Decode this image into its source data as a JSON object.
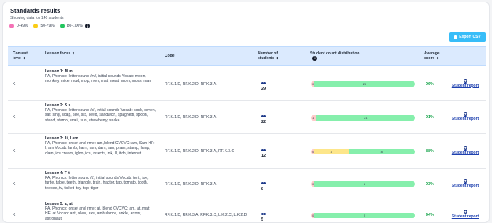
{
  "header": {
    "title": "Standards results",
    "subtitle": "Showing data for 140 students"
  },
  "legend": [
    {
      "label": "0-49%",
      "color": "#f472b6"
    },
    {
      "label": "50-79%",
      "color": "#facc15"
    },
    {
      "label": "80-100%",
      "color": "#22c55e"
    }
  ],
  "export": {
    "label": "Export CSV"
  },
  "columns": {
    "content_level": "Content level",
    "lesson_focus": "Lesson focus",
    "code": "Code",
    "students": "Number of students",
    "distribution": "Student count distribution",
    "average": "Average score"
  },
  "rows": [
    {
      "level": "K",
      "title": "Lesson 1: M m",
      "text": "PA, Phonics: letter sound /m/, initial sounds Vocab: moon, monkey, mice, mud, mop, men, mat, meat, mom, moss, man",
      "code": "RF.K.1.D, RF.K.2.D, RF.K.3.A",
      "students": "29",
      "dist": [
        {
          "c": "red",
          "v": "0",
          "w": 3
        },
        {
          "c": "green",
          "v": "29",
          "w": 97
        }
      ],
      "avg": "96%",
      "report": "Student report"
    },
    {
      "level": "K",
      "title": "Lesson 2: S s",
      "text": "PA, Phonics: letter sound /s/, initial sounds Vocab: sock, seven, sat, sing, soap, see, six, seed, sandwich, spaghetti, spoon, stand, stamp, snail, sun, strawberry, snake",
      "code": "RF.K.1.D, RF.K.2.D, RF.K.3.A",
      "students": "22",
      "dist": [
        {
          "c": "red",
          "v": "1",
          "w": 5
        },
        {
          "c": "green",
          "v": "21",
          "w": 95
        }
      ],
      "avg": "91%",
      "report": "Student report"
    },
    {
      "level": "K",
      "title": "Lesson 3: I i, I am",
      "text": "PA, Phonics: onset and rime: am, blend CVCVC: am, Sam HF: I, am Vocab: lamb, ham, ram, dam, jam, pram, stamp, lamp, clam, ice cream, igloo, ice, insects, ink, ill, itch, internet",
      "code": "RF.K.1.D, RF.K.2.D, RF.K.3.A, RF.K.3.C",
      "students": "12",
      "dist": [
        {
          "c": "red",
          "v": "0",
          "w": 3
        },
        {
          "c": "yellow",
          "v": "4",
          "w": 33
        },
        {
          "c": "green",
          "v": "8",
          "w": 64
        }
      ],
      "avg": "88%",
      "report": "Student report"
    },
    {
      "level": "K",
      "title": "Lesson 4: T t",
      "text": "PA, Phonics: letter sound /t/, initial sounds Vocab: tent, toe, turtle, table, teeth, triangle, train, tractor, tap, tomato, tooth, teepee, tv, ticket, toy, top, tiger",
      "code": "RF.K.1.D, RF.K.2.D, RF.K.3.A",
      "students": "8",
      "dist": [
        {
          "c": "red",
          "v": "0",
          "w": 3
        },
        {
          "c": "green",
          "v": "8",
          "w": 97
        }
      ],
      "avg": "93%",
      "report": "Student report"
    },
    {
      "level": "K",
      "title": "Lesson 5: a, at",
      "text": "PA, Phonics: onset and rime: at, blend CVCVC: am, at, mat; HF: at Vocab: ant, alien, axe, ambulance, ankle, arrow, astronaut",
      "code": "RF.K.1.D, RF.K.3.A, RF.K.3.C, L.K.2.C, L.K.2.D",
      "students": "5",
      "dist": [
        {
          "c": "red",
          "v": "0",
          "w": 3
        },
        {
          "c": "green",
          "v": "5",
          "w": 97
        }
      ],
      "avg": "94%",
      "report": "Student report"
    }
  ]
}
